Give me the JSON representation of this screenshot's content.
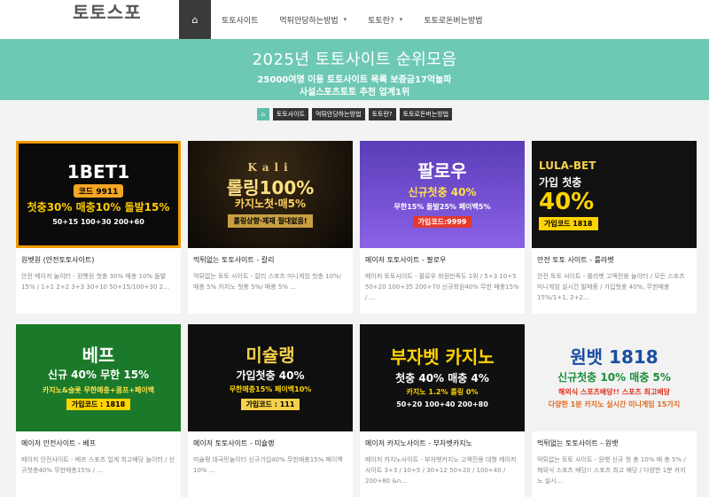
{
  "site": {
    "logo": "토토스포"
  },
  "nav": {
    "home_icon": "⌂",
    "items": [
      {
        "label": "토토사이트",
        "caret": ""
      },
      {
        "label": "먹튀안당하는방법",
        "caret": "▾"
      },
      {
        "label": "토토란?",
        "caret": "▾"
      },
      {
        "label": "토토로돈버는방법",
        "caret": ""
      }
    ]
  },
  "hero": {
    "title": "2025년 토토사이트 순위모음",
    "line1": "25000여명 이용 토토사이트 목록 보증금17억눌파",
    "line2": "사설스포츠토토 추천 업계1위"
  },
  "subnav": {
    "home_icon": "⌂",
    "items": [
      "토토사이트",
      "먹튀안당하는방법",
      "토토란?",
      "토토로돈버는방법"
    ]
  },
  "cards": [
    {
      "banner": {
        "t1": "1BET1",
        "t2": "코드 9911",
        "t3": "첫충30% 매충10% 돌발15%",
        "t4": "50+15 100+30 200+60"
      },
      "title": "원벳원 (안전토토사이트)",
      "excerpt": "안전 메이저 놀이터 - 원벳원 첫충 30% 매충 10% 돌발 15% / 1+1 2+2 3+3 30+10 50+15/100+30 2…"
    },
    {
      "banner": {
        "t1": "Kali",
        "t2": "롤링100%",
        "t3": "카지노첫·매5%",
        "t4": "롤링상향·제재 절대없음!"
      },
      "title": "먹튀없는 토토사이트 - 칼리",
      "excerpt": "먹튀없는 토토 사이트 - 칼리 스포츠 미니게임 첫충 10%/ 매충 5% 카지노 첫충 5%/ 매충 5% …"
    },
    {
      "banner": {
        "t1": "팔로우",
        "t2": "신규첫충 40%",
        "t3": "무한15% 돌발25% 페이백5%",
        "t4": "가입코드:9999"
      },
      "title": "메이저 토토사이트 - 팔로우",
      "excerpt": "메이저 토토사이트 - 팔로우 회원만족도 1위 / 5+3 10+5 50+20 100+35 200+70 신규회원40% 무한 매충15% / …"
    },
    {
      "banner": {
        "t1": "LULA-BET",
        "t2": "가입 첫충",
        "t3": "40%",
        "t4": "가입코드 1818"
      },
      "title": "안전 토토 사이트 - 룰라벳",
      "excerpt": "안전 토토 사이트 - 룰라벳 고액전용 놀이터 / 모든 스포츠 미니게임 실시간 발매중 / 가입첫충 40%, 무한매충 15%/1+1, 2+2…"
    },
    {
      "banner": {
        "t1": "베프",
        "t2": "신규 40% 무한 15%",
        "t3": "카지노&슬롯 무한매충+콤프+페이백",
        "t4": "가입코드 : 1818"
      },
      "title": "메이저 안전사이트 - 베프",
      "excerpt": "메이저 안전사이트 - 베프 스포츠 업계 최고배당 놀이터 / 신규첫충40% 무한매충15% / …"
    },
    {
      "banner": {
        "t1": "미슐랭",
        "t2": "가입첫충 40%",
        "t3": "무한매충15% 페이백10%",
        "t4": "가입코드 : 111"
      },
      "title": "메이저 토토사이트 - 미슐랭",
      "excerpt": "미슐랭 대국민놀이터 신규가입40% 무한매충15% 페이백10% …"
    },
    {
      "banner": {
        "t1": "부자벳 카지노",
        "t2": "첫충 40% 매충 4%",
        "t3": "카지노 1.2% 롤링 0%",
        "t4": "50+20 100+40 200+80"
      },
      "title": "메이저 카지노사이트 - 부자벳카지노",
      "excerpt": "메이저 카지노사이트 - 부자벳카지노 고액전용 대형 메이저사이트 3+3 / 10+5 / 30+12 50+20 / 100+40 / 200+80 &n…"
    },
    {
      "banner": {
        "t1": "원뱃 1818",
        "t2": "신규첫충 10% 매충 5%",
        "t3": "해외식 스포츠배당!! 스포츠 최고배당",
        "t4": "다양한 1분 카지노 실시간 미니게임 15가지"
      },
      "title": "먹튀없는 토토사이트 - 원뱃",
      "excerpt": "먹튀없는 토토 사이트 - 원뱃 신규 첫 충 10% 매 충 5% / 해외식 스포츠 배당!! 스포츠 최고 배당 / 다양한 1분 카지노 실시…"
    }
  ]
}
